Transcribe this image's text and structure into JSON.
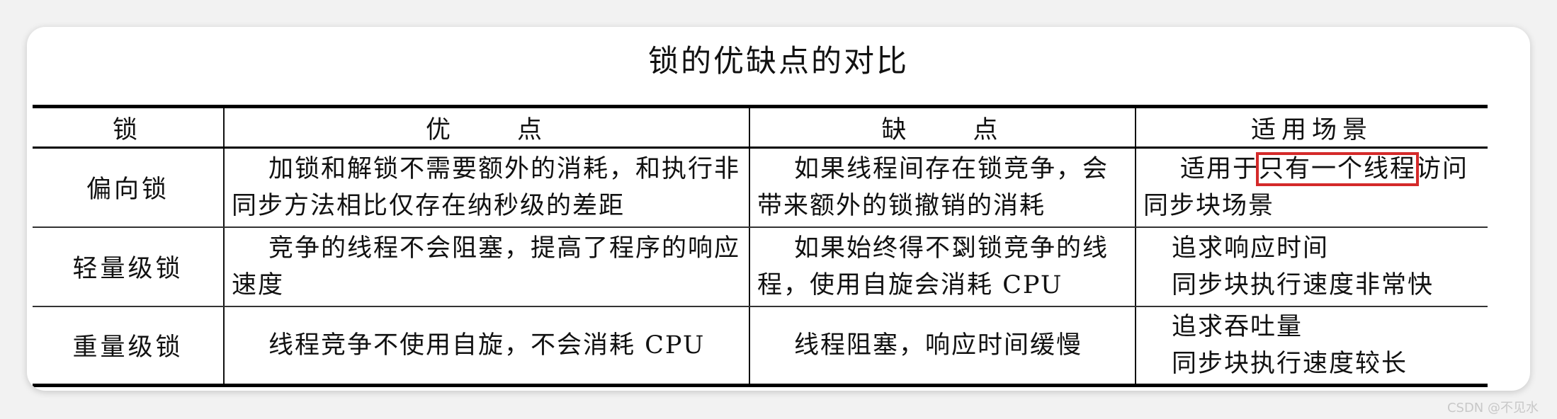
{
  "title": "锁的优缺点的对比",
  "table": {
    "headers": [
      "锁",
      "优　　点",
      "缺　　点",
      "适用场景"
    ],
    "rows": [
      {
        "lock": "偏向锁",
        "pros": "加锁和解锁不需要额外的消耗，和执行非同步方法相比仅存在纳秒级的差距",
        "cons": "如果线程间存在锁竞争，会带来额外的锁撤销的消耗",
        "scenario_pre": "适用于",
        "scenario_highlight": "只有一个线程",
        "scenario_post": "访问同步块场景"
      },
      {
        "lock": "轻量级锁",
        "pros": "竞争的线程不会阻塞，提高了程序的响应速度",
        "cons": "如果始终得不到锁竞争的线程，使用自旋会消耗 CPU",
        "scenario_lines": [
          "追求响应时间",
          "同步块执行速度非常快"
        ]
      },
      {
        "lock": "重量级锁",
        "pros": "线程竞争不使用自旋，不会消耗 CPU",
        "cons": "线程阻塞，响应时间缓慢",
        "scenario_lines": [
          "追求吞吐量",
          "同步块执行速度较长"
        ]
      }
    ]
  },
  "watermark": "CSDN @不见水",
  "colors": {
    "highlight_box": "#d42a2a",
    "background": "#f2f2f2",
    "card": "#ffffff"
  }
}
